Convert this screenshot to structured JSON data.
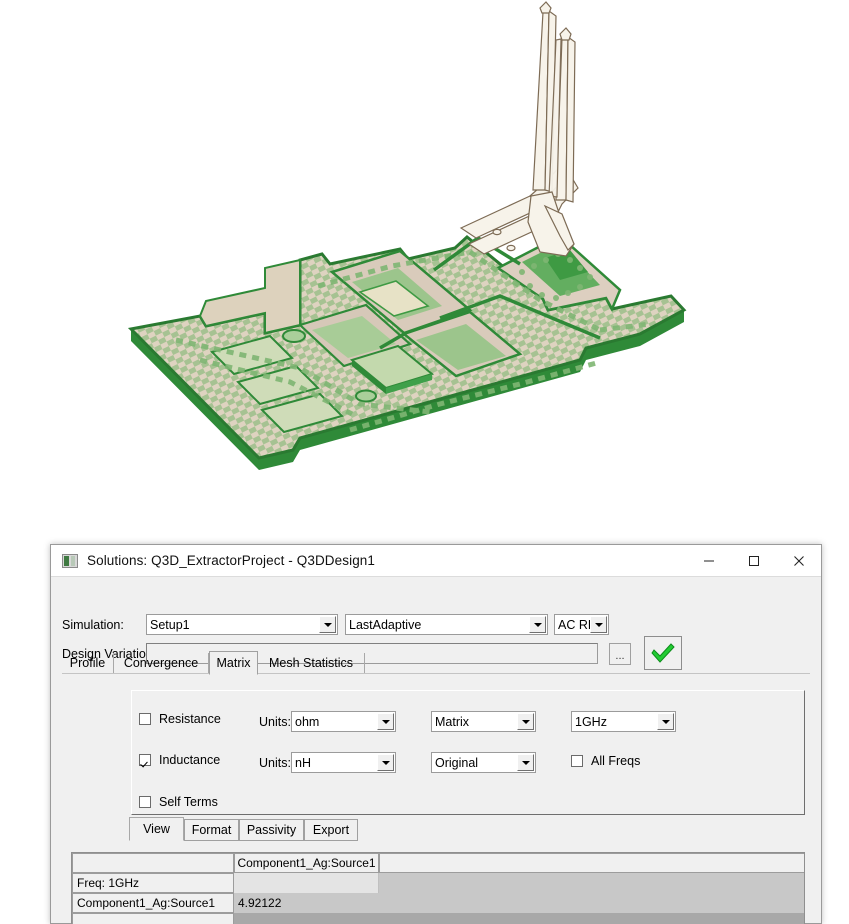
{
  "viewport": {
    "name": "q3d-3d-model-viewport",
    "description": "3D shaded model of a PCB board with bond wires",
    "colors": {
      "board_light": "#e3dfc0",
      "board_tan": "#ded0c2",
      "trace_green": "#3f9d4a",
      "trace_dark": "#2f7a36",
      "mid_green": "#8fbf7f",
      "wire_fill": "#f6f1e8",
      "wire_outline": "#7d6b55",
      "background": "#ffffff"
    }
  },
  "dialog": {
    "title": "Solutions: Q3D_ExtractorProject - Q3DDesign1",
    "icon": "q3d-app-icon",
    "window_controls": {
      "minimize": "minimize-button",
      "maximize": "maximize-button",
      "close": "close-button"
    },
    "simulation": {
      "label": "Simulation:",
      "setup_value": "Setup1",
      "solution_value": "LastAdaptive",
      "type_value": "AC RL"
    },
    "design_variation": {
      "label": "Design Variation:",
      "value": "",
      "browse_label": "...",
      "apply_label": "check-mark"
    },
    "tabs": [
      {
        "label": "Profile",
        "active": false
      },
      {
        "label": "Convergence",
        "active": false
      },
      {
        "label": "Matrix",
        "active": true
      },
      {
        "label": "Mesh Statistics",
        "active": false
      }
    ],
    "matrix_panel": {
      "resistance": {
        "label": "Resistance",
        "checked": false,
        "units_label": "Units:",
        "units_value": "ohm",
        "format_value": "Matrix",
        "freq_value": "1GHz"
      },
      "inductance": {
        "label": "Inductance",
        "checked": true,
        "units_label": "Units:",
        "units_value": "nH",
        "format_value": "Original",
        "all_freqs_label": "All Freqs",
        "all_freqs_checked": false
      },
      "self_terms": {
        "label": "Self Terms",
        "checked": false
      }
    },
    "subtabs": [
      {
        "label": "View",
        "active": true
      },
      {
        "label": "Format",
        "active": false
      },
      {
        "label": "Passivity",
        "active": false
      },
      {
        "label": "Export",
        "active": false
      }
    ],
    "results_grid": {
      "corner_label": "",
      "column_headers": [
        "Component1_Ag:Source1"
      ],
      "rows": [
        {
          "header": "Freq: 1GHz",
          "values": [
            ""
          ]
        },
        {
          "header": "Component1_Ag:Source1",
          "values": [
            "4.92122"
          ]
        }
      ]
    }
  }
}
